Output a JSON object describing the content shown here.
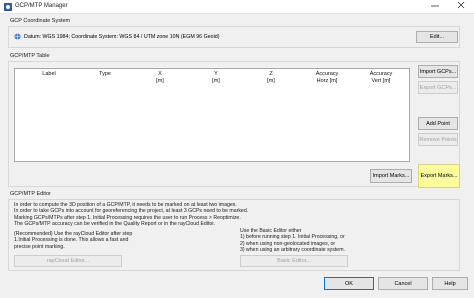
{
  "window": {
    "title": "GCP/MTP Manager",
    "controls": [
      "minimize",
      "close"
    ]
  },
  "coordinate_system": {
    "group_label": "GCP Coordinate System",
    "datum_text": "Datum: WGS 1984; Coordinate System: WGS 84 / UTM zone 10N (EGM 96 Geoid)",
    "edit_label": "Edit..."
  },
  "gcp_table": {
    "group_label": "GCP/MTP Table",
    "columns": [
      {
        "line1": "Label",
        "line2": ""
      },
      {
        "line1": "Type",
        "line2": ""
      },
      {
        "line1": "X",
        "line2": "[m]"
      },
      {
        "line1": "Y",
        "line2": "[m]"
      },
      {
        "line1": "Z",
        "line2": "[m]"
      },
      {
        "line1": "Accuracy",
        "line2": "Horz [m]"
      },
      {
        "line1": "Accuracy",
        "line2": "Vert [m]"
      }
    ],
    "rows": [],
    "side_buttons": {
      "import_gcps": "Import GCPs...",
      "export_gcps": "Export GCPs...",
      "add_point": "Add Point",
      "remove_points": "Remove Points"
    },
    "import_marks": "Import Marks...",
    "export_marks": "Export Marks..."
  },
  "editor": {
    "group_label": "GCP/MTP Editor",
    "description": [
      "In order to compute the 3D position of a GCP/MTP, it needs to be marked on at least two images.",
      "In order to take GCPs into account for georeferencing the project, at least 3 GCPs need to be marked.",
      "Marking GCPs/MTPs after step 1. Initial Processing requires the user to run Process > Reoptimize.",
      "The GCPs/MTP accuracy can be verified in the Quality Report or in the rayCloud Editor."
    ],
    "raycloud_text": [
      "(Recommended) Use the rayCloud Editor after step",
      "1.Initial Processing is done. This allows a fast and",
      "precise point marking."
    ],
    "raycloud_button": "rayCloud Editor...",
    "basic_text": [
      "Use the Basic Editor either",
      "1) before running step 1. Initial Processing, or",
      "2) when using non-geolocated images, or",
      "3) when using an arbitrary coordinate system."
    ],
    "basic_button": "Basic Editor..."
  },
  "footer": {
    "ok": "OK",
    "cancel": "Cancel",
    "help": "Help"
  },
  "colors": {
    "highlight": "#fbfc9d",
    "focus": "#0078d7"
  }
}
